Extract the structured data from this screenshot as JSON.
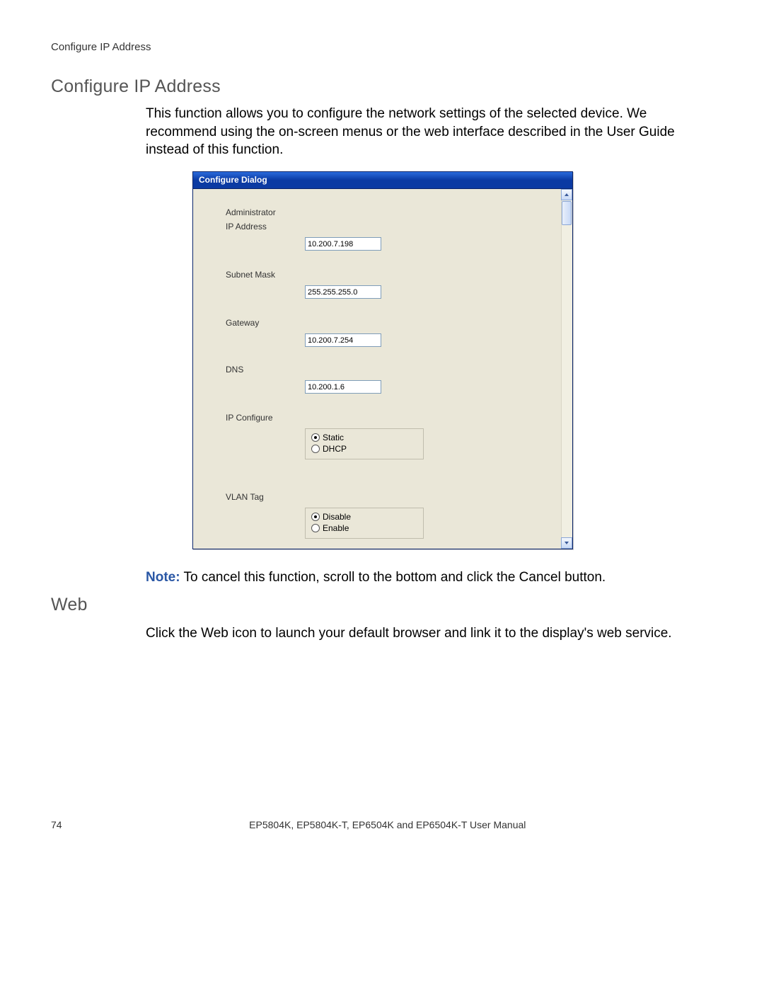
{
  "header": {
    "breadcrumb": "Configure IP Address"
  },
  "sections": {
    "configure": {
      "title": "Configure IP Address",
      "description": "This function allows you to configure the network settings of the selected device. We recommend using the on-screen menus or the web interface described in the User Guide instead of this function.",
      "note_label": "Note:",
      "note_text": " To cancel this function, scroll to the bottom and click the Cancel button."
    },
    "web": {
      "title": "Web",
      "description": "Click the Web icon to launch your default browser and link it to the display's web service."
    }
  },
  "dialog": {
    "title": "Configure Dialog",
    "labels": {
      "administrator": "Administrator",
      "ip_address": "IP Address",
      "subnet_mask": "Subnet Mask",
      "gateway": "Gateway",
      "dns": "DNS",
      "ip_configure": "IP Configure",
      "vlan_tag": "VLAN Tag"
    },
    "values": {
      "ip_address": "10.200.7.198",
      "subnet_mask": "255.255.255.0",
      "gateway": "10.200.7.254",
      "dns": "10.200.1.6"
    },
    "ip_configure_options": {
      "static": "Static",
      "dhcp": "DHCP",
      "selected": "static"
    },
    "vlan_tag_options": {
      "disable": "Disable",
      "enable": "Enable",
      "selected": "disable"
    }
  },
  "footer": {
    "page_number": "74",
    "doc_title": "EP5804K, EP5804K-T, EP6504K and EP6504K-T User Manual"
  }
}
